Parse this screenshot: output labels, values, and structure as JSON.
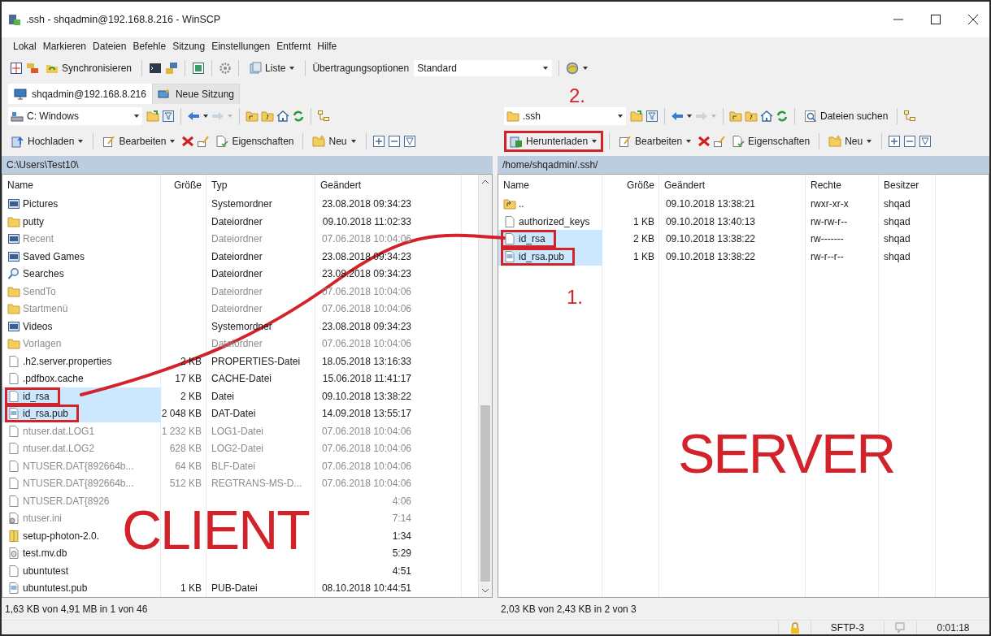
{
  "window": {
    "title": ".ssh - shqadmin@192.168.8.216 - WinSCP"
  },
  "menu": [
    "Lokal",
    "Markieren",
    "Dateien",
    "Befehle",
    "Sitzung",
    "Einstellungen",
    "Entfernt",
    "Hilfe"
  ],
  "toolbar": {
    "sync_label": "Synchronisieren",
    "list_label": "Liste",
    "transfer_label": "Übertragungsoptionen",
    "transfer_preset": "Standard"
  },
  "session_tabs": [
    {
      "label": "shqadmin@192.168.8.216",
      "selected": true
    },
    {
      "label": "Neue Sitzung",
      "selected": false
    }
  ],
  "panes": [
    {
      "kind": "local",
      "location": "C: Windows",
      "actions": [
        {
          "kind": "transfer",
          "label": "Hochladen",
          "dropdown": true,
          "highlighted": false
        },
        {
          "kind": "edit",
          "label": "Bearbeiten",
          "dropdown": true,
          "highlighted": false
        },
        {
          "kind": "properties",
          "label": "Eigenschaften",
          "dropdown": false,
          "highlighted": false
        },
        {
          "kind": "new",
          "label": "Neu",
          "dropdown": true,
          "highlighted": false
        }
      ],
      "path": "C:\\Users\\Test10\\",
      "columns": [
        "Name",
        "Größe",
        "Typ",
        "Geändert"
      ],
      "rows": [
        {
          "kind": "system",
          "name": "Pictures",
          "type": "Systemordner",
          "modified": "23.08.2018 09:34:23",
          "selected": false,
          "dimmed": false,
          "highlighted": false
        },
        {
          "kind": "folder",
          "name": "putty",
          "type": "Dateiordner",
          "modified": "09.10.2018 11:02:33",
          "selected": false,
          "dimmed": false,
          "highlighted": false
        },
        {
          "kind": "system",
          "name": "Recent",
          "type": "Dateiordner",
          "modified": "07.06.2018 10:04:06",
          "selected": false,
          "dimmed": true,
          "highlighted": false
        },
        {
          "kind": "system",
          "name": "Saved Games",
          "type": "Dateiordner",
          "modified": "23.08.2018 09:34:23",
          "selected": false,
          "dimmed": false,
          "highlighted": false
        },
        {
          "kind": "search",
          "name": "Searches",
          "type": "Dateiordner",
          "modified": "23.08.2018 09:34:23",
          "selected": false,
          "dimmed": false,
          "highlighted": false
        },
        {
          "kind": "folder",
          "name": "SendTo",
          "type": "Dateiordner",
          "modified": "07.06.2018 10:04:06",
          "selected": false,
          "dimmed": true,
          "highlighted": false
        },
        {
          "kind": "folder",
          "name": "Startmenü",
          "type": "Dateiordner",
          "modified": "07.06.2018 10:04:06",
          "selected": false,
          "dimmed": true,
          "highlighted": false
        },
        {
          "kind": "system",
          "name": "Videos",
          "type": "Systemordner",
          "modified": "23.08.2018 09:34:23",
          "selected": false,
          "dimmed": false,
          "highlighted": false
        },
        {
          "kind": "folder",
          "name": "Vorlagen",
          "type": "Dateiordner",
          "modified": "07.06.2018 10:04:06",
          "selected": false,
          "dimmed": true,
          "highlighted": false
        },
        {
          "kind": "file",
          "name": ".h2.server.properties",
          "size": "2 KB",
          "type": "PROPERTIES-Datei",
          "modified": "18.05.2018 13:16:33",
          "selected": false,
          "dimmed": false,
          "highlighted": false
        },
        {
          "kind": "file",
          "name": ".pdfbox.cache",
          "size": "17 KB",
          "type": "CACHE-Datei",
          "modified": "15.06.2018 11:41:17",
          "selected": false,
          "dimmed": false,
          "highlighted": false
        },
        {
          "kind": "file",
          "name": "id_rsa",
          "size": "2 KB",
          "type": "Datei",
          "modified": "09.10.2018 13:38:22",
          "selected": true,
          "dimmed": false,
          "highlighted": true
        },
        {
          "kind": "key",
          "name": "id_rsa.pub",
          "size": "2 048 KB",
          "type": "DAT-Datei",
          "modified": "14.09.2018 13:55:17",
          "selected": true,
          "dimmed": false,
          "highlighted": true
        },
        {
          "kind": "file",
          "name": "ntuser.dat.LOG1",
          "size": "1 232 KB",
          "type": "LOG1-Datei",
          "modified": "07.06.2018 10:04:06",
          "selected": false,
          "dimmed": true,
          "highlighted": false
        },
        {
          "kind": "file",
          "name": "ntuser.dat.LOG2",
          "size": "628 KB",
          "type": "LOG2-Datei",
          "modified": "07.06.2018 10:04:06",
          "selected": false,
          "dimmed": true,
          "highlighted": false
        },
        {
          "kind": "file",
          "name": "NTUSER.DAT{892664b...",
          "size": "64 KB",
          "type": "BLF-Datei",
          "modified": "07.06.2018 10:04:06",
          "selected": false,
          "dimmed": true,
          "highlighted": false
        },
        {
          "kind": "file",
          "name": "NTUSER.DAT{892664b...",
          "size": "512 KB",
          "type": "REGTRANS-MS-D...",
          "modified": "07.06.2018 10:04:06",
          "selected": false,
          "dimmed": true,
          "highlighted": false
        },
        {
          "kind": "file",
          "name": "NTUSER.DAT{8926",
          "modified": "4:06",
          "selected": false,
          "dimmed": true,
          "highlighted": false
        },
        {
          "kind": "settings",
          "name": "ntuser.ini",
          "modified": "7:14",
          "selected": false,
          "dimmed": true,
          "highlighted": false
        },
        {
          "kind": "archive",
          "name": "setup-photon-2.0.",
          "modified": "1:34",
          "selected": false,
          "dimmed": false,
          "highlighted": false
        },
        {
          "kind": "database",
          "name": "test.mv.db",
          "modified": "5:29",
          "selected": false,
          "dimmed": false,
          "highlighted": false
        },
        {
          "kind": "file",
          "name": "ubuntutest",
          "modified": "4:51",
          "selected": false,
          "dimmed": false,
          "highlighted": false
        },
        {
          "kind": "key",
          "name": "ubuntutest.pub",
          "size": "1 KB",
          "type": "PUB-Datei",
          "modified": "08.10.2018 10:44:51",
          "selected": false,
          "dimmed": false,
          "highlighted": false
        }
      ],
      "status": "1,63 KB von 4,91 MB in 1 von 46"
    },
    {
      "kind": "remote",
      "location": ".ssh",
      "search_label": "Dateien suchen",
      "actions": [
        {
          "kind": "transfer",
          "label": "Herunterladen",
          "dropdown": true,
          "highlighted": true
        },
        {
          "kind": "edit",
          "label": "Bearbeiten",
          "dropdown": true,
          "highlighted": false
        },
        {
          "kind": "properties",
          "label": "Eigenschaften",
          "dropdown": false,
          "highlighted": false
        },
        {
          "kind": "new",
          "label": "Neu",
          "dropdown": true,
          "highlighted": false
        }
      ],
      "path": "/home/shqadmin/.ssh/",
      "columns": [
        "Name",
        "Größe",
        "Geändert",
        "Rechte",
        "Besitzer"
      ],
      "rows": [
        {
          "kind": "parent",
          "name": "..",
          "modified": "09.10.2018 13:38:21",
          "rights": "rwxr-xr-x",
          "owner": "shqad",
          "selected": false,
          "dimmed": false,
          "highlighted": false
        },
        {
          "kind": "file",
          "name": "authorized_keys",
          "size": "1 KB",
          "modified": "09.10.2018 13:40:13",
          "rights": "rw-rw-r--",
          "owner": "shqad",
          "selected": false,
          "dimmed": false,
          "highlighted": false
        },
        {
          "kind": "file",
          "name": "id_rsa",
          "size": "2 KB",
          "modified": "09.10.2018 13:38:22",
          "rights": "rw-------",
          "owner": "shqad",
          "selected": true,
          "dimmed": false,
          "highlighted": true
        },
        {
          "kind": "key",
          "name": "id_rsa.pub",
          "size": "1 KB",
          "modified": "09.10.2018 13:38:22",
          "rights": "rw-r--r--",
          "owner": "shqad",
          "selected": true,
          "dimmed": false,
          "highlighted": true
        }
      ],
      "status": "2,03 KB von 2,43 KB in 2 von 3"
    }
  ],
  "status_bar": {
    "protocol": "SFTP-3",
    "elapsed": "0:01:18"
  },
  "annotations": [
    {
      "kind": "step",
      "text": "2."
    },
    {
      "kind": "step",
      "text": "1."
    },
    {
      "kind": "zone",
      "text": "CLIENT"
    },
    {
      "kind": "zone",
      "text": "SERVER"
    },
    {
      "kind": "connector"
    }
  ]
}
